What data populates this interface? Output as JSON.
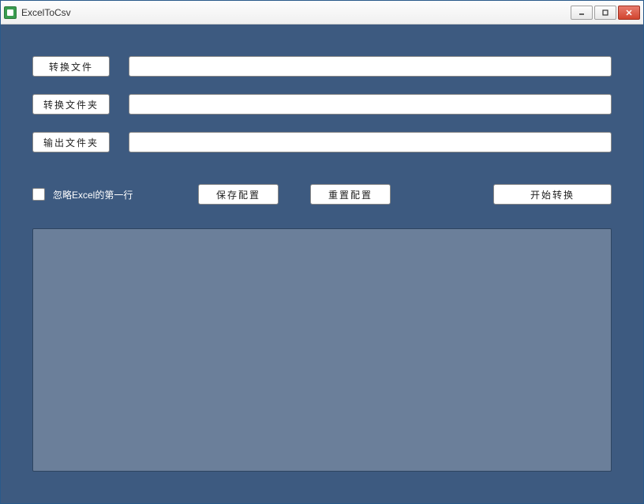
{
  "window": {
    "title": "ExcelToCsv"
  },
  "form": {
    "convert_file_label": "转换文件",
    "convert_file_value": "",
    "convert_folder_label": "转换文件夹",
    "convert_folder_value": "",
    "output_folder_label": "输出文件夹",
    "output_folder_value": ""
  },
  "options": {
    "ignore_first_row_label": "忽略Excel的第一行",
    "ignore_first_row_checked": false
  },
  "actions": {
    "save_config_label": "保存配置",
    "reset_config_label": "重置配置",
    "start_convert_label": "开始转换"
  },
  "log": {
    "content": ""
  }
}
